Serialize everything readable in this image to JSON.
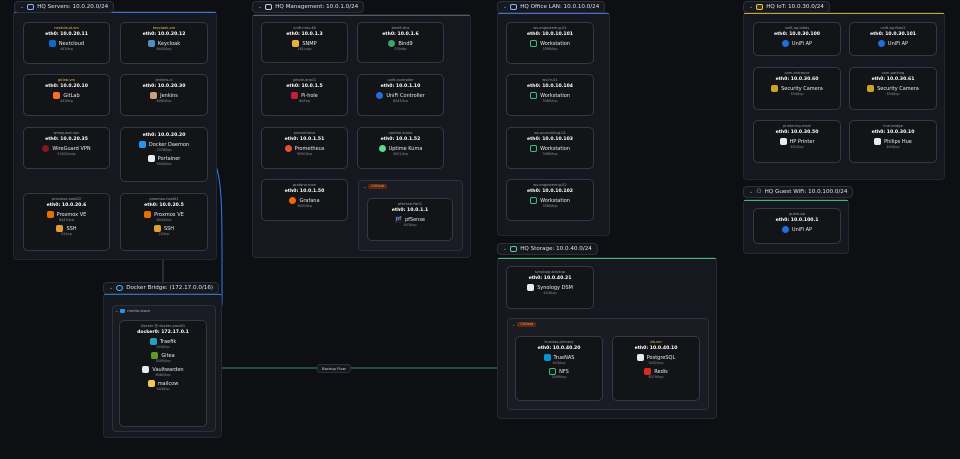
{
  "colors": {
    "servers": "#3d6fd6",
    "management": "#555b66",
    "office": "#3d6fd6",
    "iot": "#c9a227",
    "guest": "#3dbb6c",
    "storage": "#3dbb6c",
    "docker": "#2f6fbf",
    "edge_line": "#2f7ff0",
    "edge_line2": "#3ac07a"
  },
  "groups": {
    "servers": {
      "title": "HQ Servers: 10.0.20.0/24"
    },
    "management": {
      "title": "HQ Management: 10.0.1.0/24"
    },
    "office": {
      "title": "HQ Office LAN: 10.0.10.0/24"
    },
    "iot": {
      "title": "HQ IoT: 10.0.30.0/24"
    },
    "guest": {
      "title": "HQ Guest WiFi: 10.0.100.0/24"
    },
    "storage": {
      "title": "HQ Storage: 10.0.40.0/24"
    },
    "docker": {
      "title": "Docker Bridge: (172.17.0.0/16)"
    }
  },
  "labels": {
    "critical": "Critical",
    "media_stack": "media-stack",
    "backup_flow": "Backup Flow"
  },
  "nodes": {
    "nextcloud": {
      "host": "nextcloud-vm",
      "ip": "eth0: 10.0.20.11",
      "svc": "Nextcloud",
      "port": "443/tcp"
    },
    "keycloak": {
      "host": "keycloak-vm",
      "ip": "eth0: 10.0.20.12",
      "svc": "Keycloak",
      "port": "8443/tcp"
    },
    "gitlab": {
      "host": "gitlab-vm",
      "ip": "eth0: 10.0.20.10",
      "svc": "GitLab",
      "port": "443/tcp"
    },
    "jenkins": {
      "host": "jenkins-ci",
      "ip": "eth0: 10.0.20.30",
      "svc": "Jenkins",
      "port": "8080/tcp"
    },
    "wireguard": {
      "host": "wireguard-vpn",
      "ip": "eth0: 10.0.20.35",
      "svc": "WireGuard VPN",
      "port": "51820/udp"
    },
    "dockerhost": {
      "host": "",
      "ip": "eth0: 10.0.20.20",
      "svc": "Docker Daemon",
      "port": "2376/tcp",
      "svc2": "Portainer",
      "port2": "9000/tcp"
    },
    "proxmox2": {
      "host": "proxmox-host02",
      "ip": "eth0: 10.0.20.6",
      "svc": "Proxmox VE",
      "port": "8443/tcp",
      "svc2": "SSH",
      "port2": "22/tcp"
    },
    "proxmox1": {
      "host": "proxmox-host01",
      "ip": "eth0: 10.0.20.5",
      "svc": "Proxmox VE",
      "port": "8443/tcp",
      "svc2": "SSH",
      "port2": "22/tcp"
    },
    "unifi_nms": {
      "host": "unifi-nms-48",
      "ip": "eth0: 10.0.1.3",
      "svc": "SNMP",
      "port": "161/udp"
    },
    "bind9": {
      "host": "bind9-dns",
      "ip": "eth0: 10.0.1.6",
      "svc": "Bind9",
      "port": "53/udp"
    },
    "pihole": {
      "host": "pihole-dns01",
      "ip": "eth0: 10.0.1.5",
      "svc": "Pi-hole",
      "port": "80/tcp"
    },
    "unifi_ctrl": {
      "host": "unifi-controller",
      "ip": "eth0: 10.0.1.10",
      "svc": "UniFi Controller",
      "port": "8443/tcp"
    },
    "prometheus": {
      "host": "prometheus",
      "ip": "eth0: 10.0.1.51",
      "svc": "Prometheus",
      "port": "9090/tcp"
    },
    "uptime": {
      "host": "uptime-kuma",
      "ip": "eth0: 10.0.1.52",
      "svc": "Uptime Kuma",
      "port": "3001/tcp"
    },
    "grafana": {
      "host": "grafana-mon",
      "ip": "eth0: 10.0.1.50",
      "svc": "Grafana",
      "port": "3000/tcp"
    },
    "pfsense": {
      "host": "pfsense-fw01",
      "ip": "eth0: 10.0.1.1",
      "svc": "pfSense",
      "port": "443/tcp"
    },
    "ws01": {
      "host": "ws-engineering-01",
      "ip": "eth0: 10.0.10.101",
      "svc": "Workstation",
      "port": "3389/tcp"
    },
    "ws_hr": {
      "host": "ws-hr-01",
      "ip": "eth0: 10.0.10.104",
      "svc": "Workstation",
      "port": "3389/tcp"
    },
    "ws_acct": {
      "host": "ws-accounting-01",
      "ip": "eth0: 10.0.10.103",
      "svc": "Workstation",
      "port": "3389/tcp"
    },
    "ws02": {
      "host": "ws-engineering-02",
      "ip": "eth0: 10.0.10.102",
      "svc": "Workstation",
      "port": "3389/tcp"
    },
    "ap_lobby": {
      "host": "unifi-ap-lobby",
      "ip": "eth0: 10.0.30.100",
      "svc": "UniFi AP",
      "port": ""
    },
    "ap_floor2": {
      "host": "unifi-ap-floor2",
      "ip": "eth0: 10.0.30.101",
      "svc": "UniFi AP",
      "port": ""
    },
    "cam_entrance": {
      "host": "cam-entrance",
      "ip": "eth0: 10.0.30.60",
      "svc": "Security Camera",
      "port": "554/tcp"
    },
    "cam_parking": {
      "host": "cam-parking",
      "ip": "eth0: 10.0.30.61",
      "svc": "Security Camera",
      "port": "554/tcp"
    },
    "printer": {
      "host": "printer-hp-main",
      "ip": "eth0: 10.0.30.50",
      "svc": "HP Printer",
      "port": "631/tcp"
    },
    "hue": {
      "host": "hue-bridge",
      "ip": "eth0: 10.0.30.10",
      "svc": "Philips Hue",
      "port": "443/tcp"
    },
    "guest_ap": {
      "host": "guest-ap",
      "ip": "eth0: 10.0.100.1",
      "svc": "UniFi AP",
      "port": ""
    },
    "synology": {
      "host": "synology-backup",
      "ip": "eth0: 10.0.40.21",
      "svc": "Synology DSM",
      "port": "443/tcp"
    },
    "truenas": {
      "host": "truenas-primary",
      "ip": "eth0: 10.0.40.20",
      "svc": "TrueNAS",
      "port": "443/tcp",
      "svc2": "NFS",
      "port2": "2049/tcp"
    },
    "dbvm": {
      "host": "db-vm",
      "ip": "eth0: 10.0.40.10",
      "svc": "PostgreSQL",
      "port": "5432/tcp",
      "svc2": "Redis",
      "port2": "6379/tcp"
    },
    "docker_host": {
      "host": "Docker @ docker-prod01",
      "ip": "docker0: 172.17.0.1",
      "svc": "Traefik",
      "port": "443/tcp",
      "svc2": "Gitea",
      "port2": "3000/tcp",
      "svc3": "Vaultwarden",
      "port3": "8080/tcp",
      "svc4": "mailcow",
      "port4": "443/tcp"
    }
  }
}
